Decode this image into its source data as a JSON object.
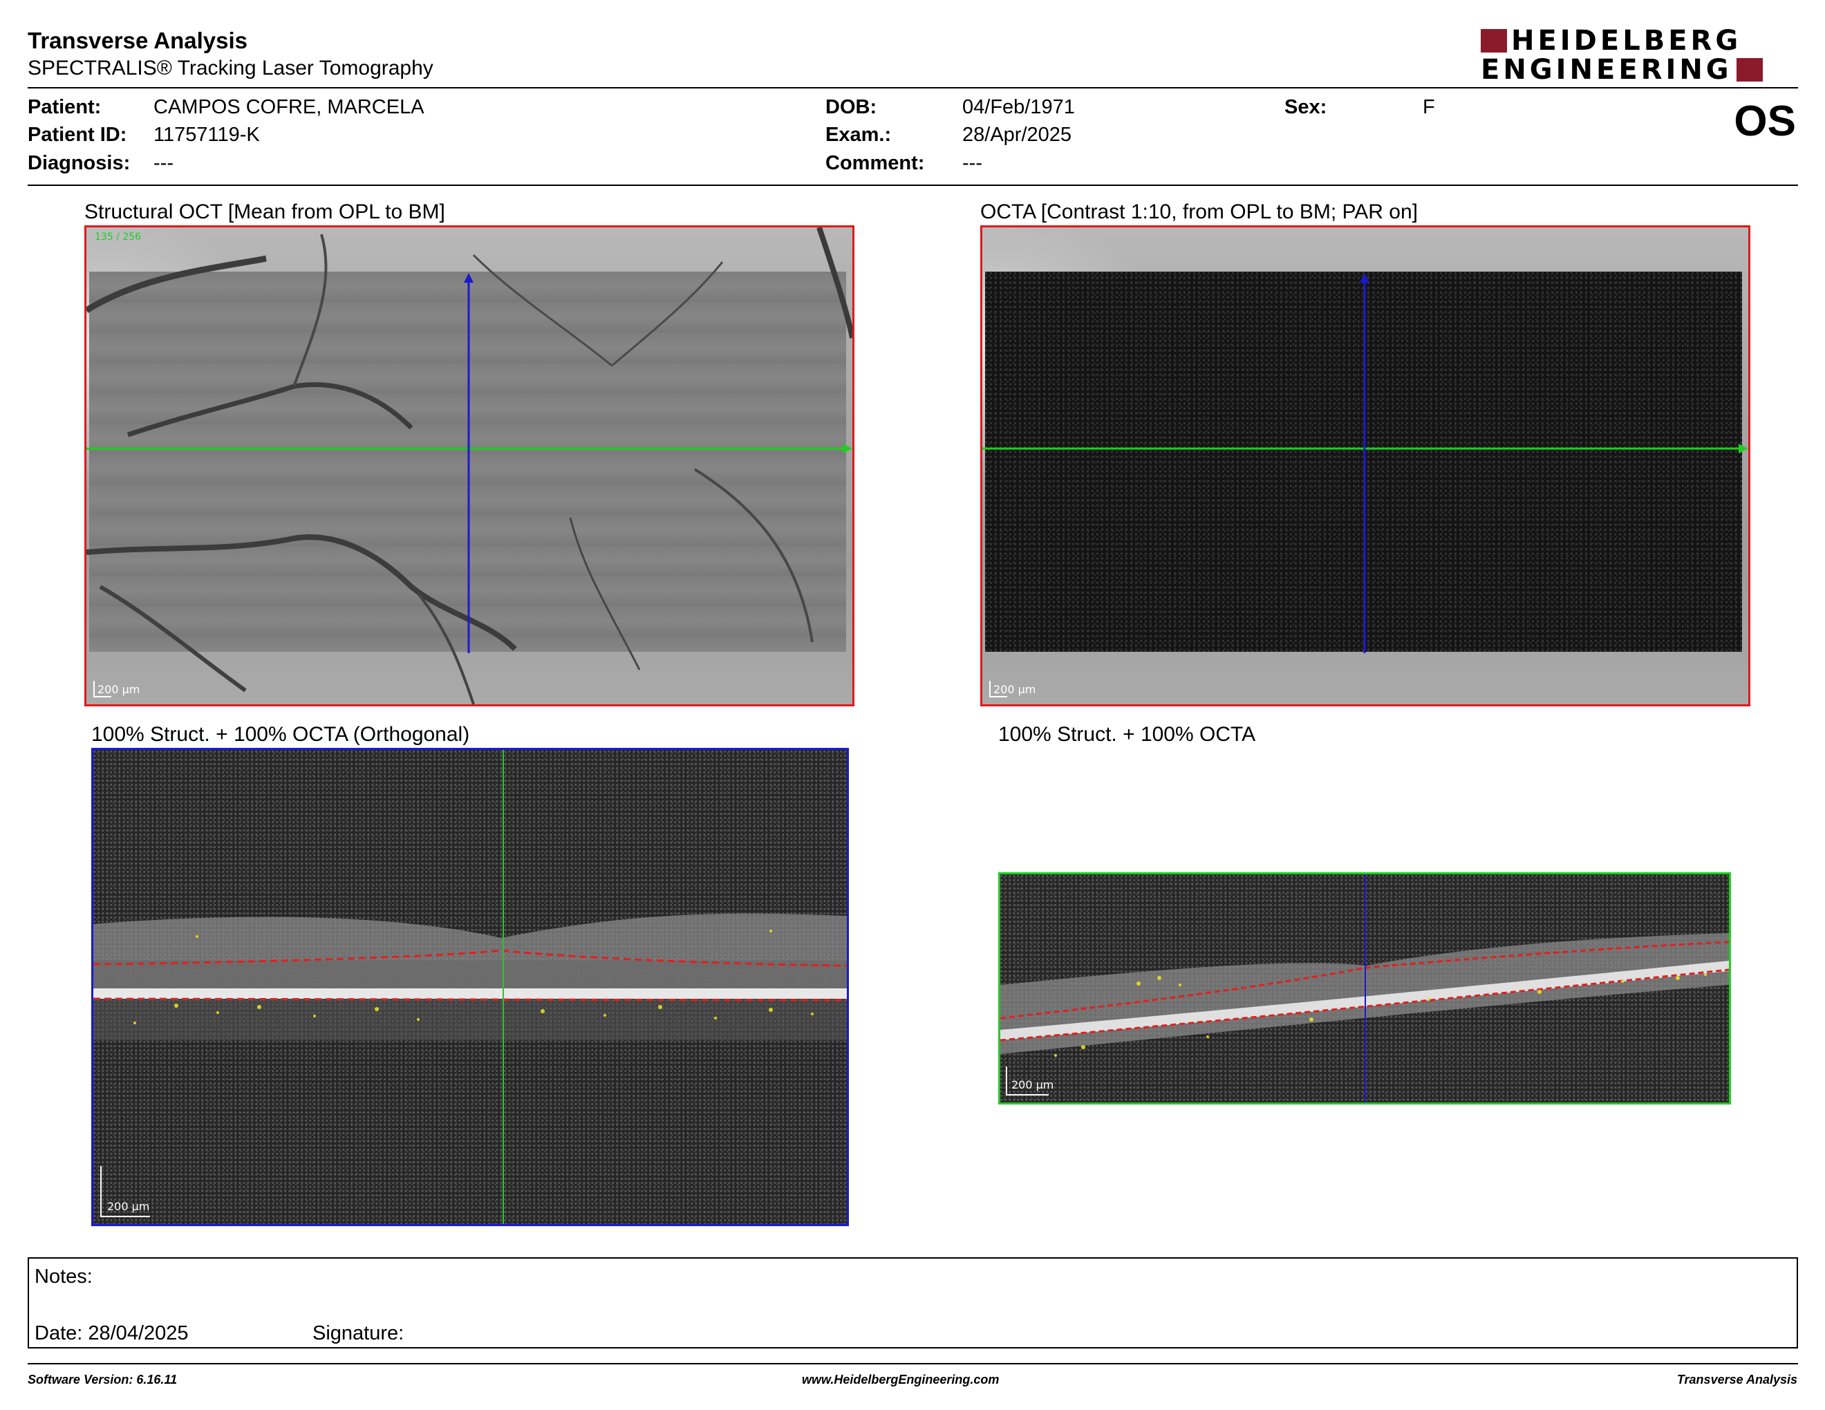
{
  "header": {
    "title": "Transverse Analysis",
    "subtitle": "SPECTRALIS® Tracking Laser Tomography",
    "logo_line1": "HEIDELBERG",
    "logo_line2": "ENGINEERING",
    "eye": "OS",
    "brand_color": "#8b1a2b"
  },
  "patient": {
    "patient_label": "Patient:",
    "patient_value": "CAMPOS COFRE, MARCELA",
    "id_label": "Patient ID:",
    "id_value": "11757119-K",
    "diagnosis_label": "Diagnosis:",
    "diagnosis_value": "---",
    "dob_label": "DOB:",
    "dob_value": "04/Feb/1971",
    "exam_label": "Exam.:",
    "exam_value": "28/Apr/2025",
    "comment_label": "Comment:",
    "comment_value": "---",
    "sex_label": "Sex:",
    "sex_value": "F"
  },
  "panels": {
    "structural": {
      "caption": "Structural OCT [Mean from OPL to BM]",
      "overlay": "135 / 256",
      "scale": "200 µm"
    },
    "octa": {
      "caption": "OCTA [Contrast 1:10, from OPL to BM; PAR on]",
      "scale": "200 µm"
    },
    "orthogonal": {
      "caption": "100% Struct. + 100% OCTA (Orthogonal)",
      "scale": "200 µm"
    },
    "combined": {
      "caption": "100% Struct. + 100% OCTA",
      "scale": "200 µm"
    }
  },
  "notes": {
    "notes_label": "Notes:",
    "date_label": "Date: 28/04/2025",
    "signature_label": "Signature:"
  },
  "footer": {
    "software": "Software Version: 6.16.11",
    "website": "www.HeidelbergEngineering.com",
    "report": "Transverse Analysis"
  },
  "colors": {
    "structural_border": "#e0191c",
    "orthogonal_border": "#1a1ad0",
    "combined_border": "#22cc22",
    "horizontal_line": "#22cc22",
    "vertical_line": "#1a1acc",
    "segment_line": "#e02020",
    "octa_overlay": "#e8e020"
  }
}
